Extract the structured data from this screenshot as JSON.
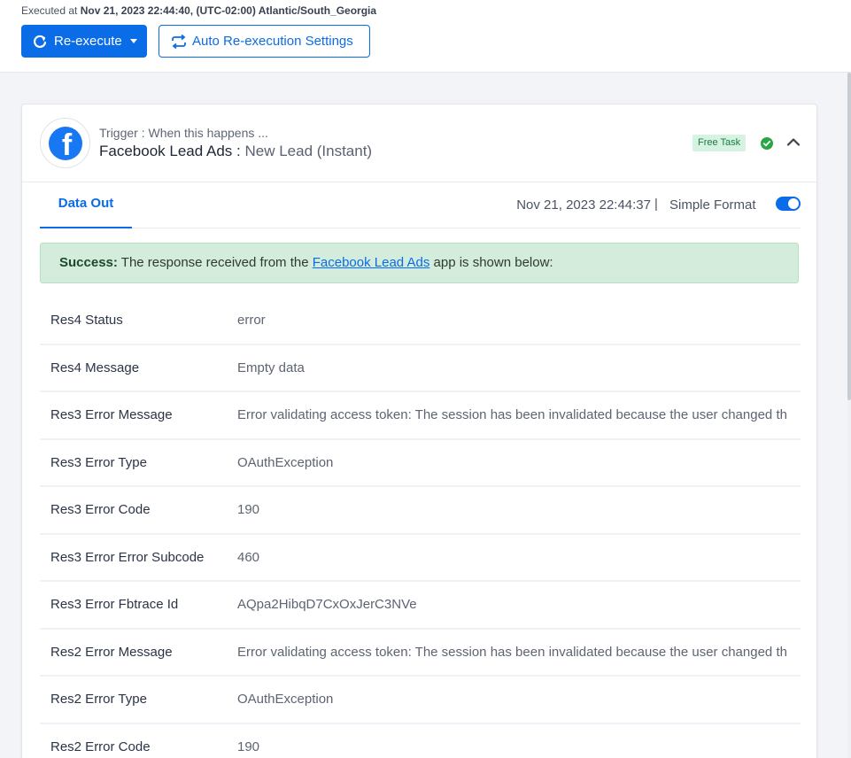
{
  "header": {
    "executed_prefix": "Executed at",
    "executed_value": "Nov 21, 2023 22:44:40, (UTC-02:00) Atlantic/South_Georgia",
    "reexecute_label": "Re-execute",
    "auto_label": "Auto Re-execution Settings"
  },
  "trigger": {
    "label": "Trigger : When this happens ...",
    "app": "Facebook Lead Ads :",
    "event": "New Lead (Instant)",
    "badge": "Free Task",
    "logo_letter": "f"
  },
  "tabs": {
    "data_out": "Data Out",
    "timestamp": "Nov 21, 2023 22:44:37",
    "separator": "|",
    "format_label": "Simple Format",
    "format_on": true
  },
  "banner": {
    "strong": "Success:",
    "text_before": "The response received from the",
    "link": "Facebook Lead Ads",
    "text_after": "app is shown below:"
  },
  "rows": [
    {
      "key": "Res4 Status",
      "value": "error"
    },
    {
      "key": "Res4 Message",
      "value": "Empty data"
    },
    {
      "key": "Res3 Error Message",
      "value": "Error validating access token: The session has been invalidated because the user changed th"
    },
    {
      "key": "Res3 Error Type",
      "value": "OAuthException"
    },
    {
      "key": "Res3 Error Code",
      "value": "190"
    },
    {
      "key": "Res3 Error Error Subcode",
      "value": "460"
    },
    {
      "key": "Res3 Error Fbtrace Id",
      "value": "AQpa2HibqD7CxOxJerC3NVe"
    },
    {
      "key": "Res2 Error Message",
      "value": "Error validating access token: The session has been invalidated because the user changed th"
    },
    {
      "key": "Res2 Error Type",
      "value": "OAuthException"
    },
    {
      "key": "Res2 Error Code",
      "value": "190"
    }
  ],
  "colors": {
    "primary": "#0b6ce8",
    "facebook": "#1877f2",
    "success_bg": "#d3ecdb",
    "badge_bg": "#d6f2e0",
    "check": "#28a745"
  },
  "icons": {
    "reexecute": "refresh-icon",
    "auto": "repeat-icon",
    "status": "check-circle-icon",
    "collapse": "chevron-up-icon"
  }
}
